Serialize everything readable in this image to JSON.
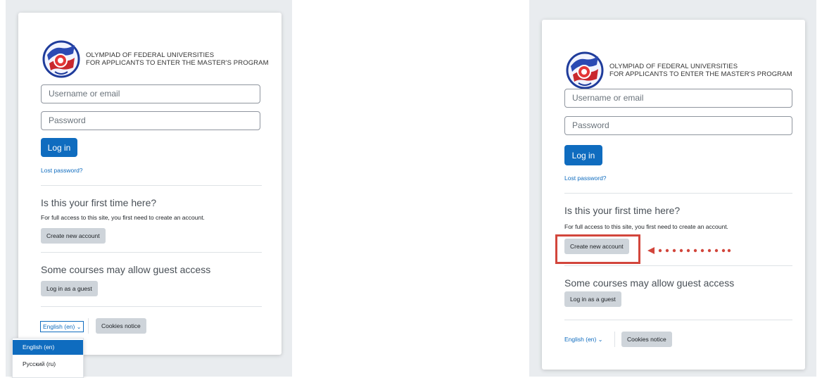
{
  "left_panel": {
    "logo_line1": "OLYMPIAD OF FEDERAL UNIVERSITIES",
    "logo_line2": "FOR APPLICANTS TO ENTER THE MASTER'S PROGRAM",
    "username_placeholder": "Username or email",
    "password_placeholder": "Password",
    "login_button": "Log in",
    "lost_password": "Lost password?",
    "first_time_heading": "Is this your first time here?",
    "first_time_text": "For full access to this site, you first need to create an account.",
    "create_account_button": "Create new account",
    "guest_heading": "Some courses may allow guest access",
    "guest_button": "Log in as a guest",
    "language_selector": "English (en)",
    "cookies_button": "Cookies notice",
    "language_menu": {
      "options": [
        "English (en)",
        "Русский (ru)"
      ],
      "selected": "English (en)"
    }
  },
  "right_panel": {
    "logo_line1": "OLYMPIAD OF FEDERAL UNIVERSITIES",
    "logo_line2": "FOR APPLICANTS TO ENTER THE MASTER'S PROGRAM",
    "username_placeholder": "Username or email",
    "password_placeholder": "Password",
    "login_button": "Log in",
    "lost_password": "Lost password?",
    "first_time_heading": "Is this your first time here?",
    "first_time_text": "For full access to this site, you first need to create an account.",
    "create_account_button": "Create new account",
    "guest_heading": "Some courses may allow guest access",
    "guest_button": "Log in as a guest",
    "language_selector": "English (en)",
    "cookies_button": "Cookies notice"
  },
  "colors": {
    "primary": "#0f6cbf",
    "secondary_button": "#ced4da",
    "background": "#e9ecef",
    "annotation": "#d2463c"
  },
  "icons": {
    "logo": "olympiad-emblem",
    "dropdown": "chevron-down-icon",
    "annotation_arrow": "arrow-left-icon"
  }
}
